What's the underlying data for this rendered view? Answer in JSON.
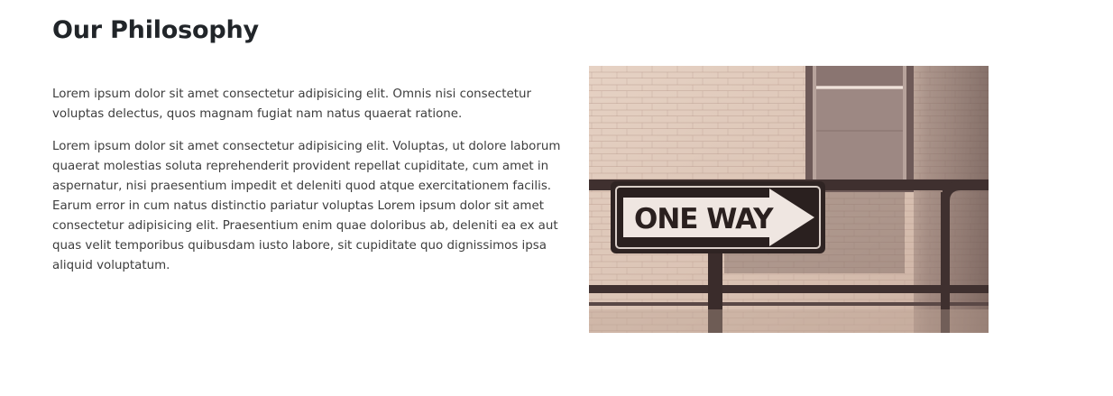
{
  "section": {
    "title": "Our Philosophy",
    "paragraphs": [
      "Lorem ipsum dolor sit amet consectetur adipisicing elit. Omnis nisi consectetur voluptas delectus, quos magnam fugiat nam natus quaerat ratione.",
      "Lorem ipsum dolor sit amet consectetur adipisicing elit. Voluptas, ut dolore laborum quaerat molestias soluta reprehenderit provident repellat cupiditate, cum amet in aspernatur, nisi praesentium impedit et deleniti quod atque exercitationem facilis. Earum error in cum natus distinctio pariatur voluptas Lorem ipsum dolor sit amet consectetur adipisicing elit. Praesentium enim quae doloribus ab, deleniti ea ex aut quas velit temporibus quibusdam iusto labore, sit cupiditate quo dignissimos ipsa aliquid voluptatum."
    ],
    "image": {
      "sign_text": "ONE WAY"
    }
  }
}
